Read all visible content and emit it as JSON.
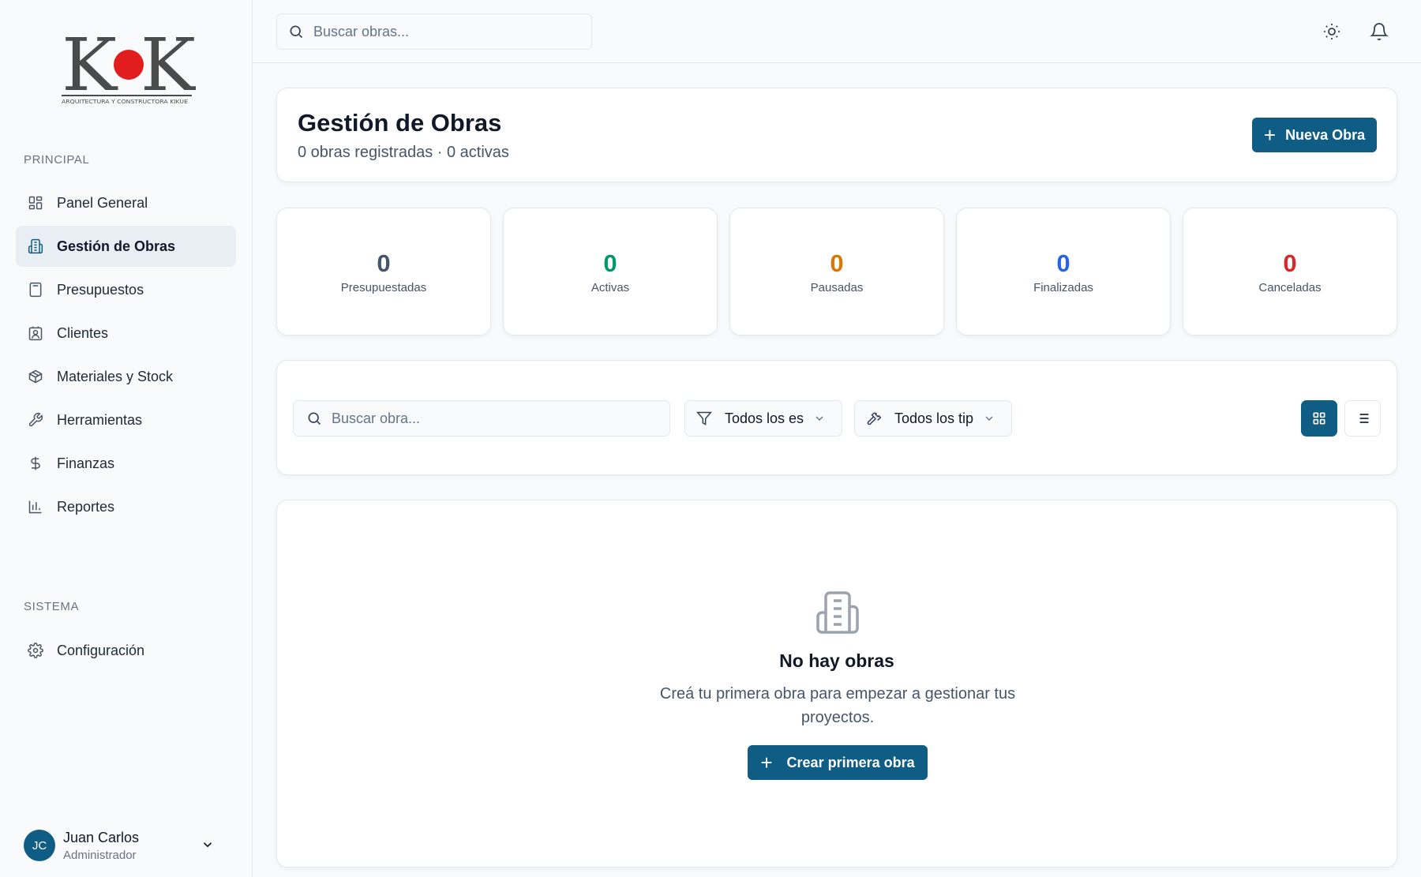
{
  "brand": {
    "logo_text": "KK",
    "logo_subtitle": "ARQUITECTURA Y CONSTRUCTORA KIKUE",
    "accent": "#0f5c85",
    "logo_red": "#e11d1d"
  },
  "topbar": {
    "search_placeholder": "Buscar obras...",
    "icons": [
      "sun-icon",
      "bell-icon"
    ]
  },
  "sidebar": {
    "section_principal": "PRINCIPAL",
    "section_sistema": "SISTEMA",
    "items": [
      {
        "label": "Panel General",
        "icon": "dashboard-icon"
      },
      {
        "label": "Gestión de Obras",
        "icon": "building-icon",
        "active": true
      },
      {
        "label": "Presupuestos",
        "icon": "calculator-icon"
      },
      {
        "label": "Clientes",
        "icon": "contact-icon"
      },
      {
        "label": "Materiales y Stock",
        "icon": "box-icon"
      },
      {
        "label": "Herramientas",
        "icon": "wrench-icon"
      },
      {
        "label": "Finanzas",
        "icon": "dollar-icon"
      },
      {
        "label": "Reportes",
        "icon": "bar-chart-icon"
      }
    ],
    "system_items": [
      {
        "label": "Configuración",
        "icon": "gear-icon"
      }
    ],
    "user": {
      "initials": "JC",
      "name": "Juan Carlos",
      "role": "Administrador"
    }
  },
  "header": {
    "title": "Gestión de Obras",
    "subtitle": "0 obras registradas · 0 activas",
    "new_button": "Nueva Obra"
  },
  "stats": [
    {
      "value": "0",
      "label": "Presupuestadas",
      "color": "#475569"
    },
    {
      "value": "0",
      "label": "Activas",
      "color": "#059669"
    },
    {
      "value": "0",
      "label": "Pausadas",
      "color": "#d97706"
    },
    {
      "value": "0",
      "label": "Finalizadas",
      "color": "#2563eb"
    },
    {
      "value": "0",
      "label": "Canceladas",
      "color": "#dc2626"
    }
  ],
  "filters": {
    "search_placeholder": "Buscar obra...",
    "status_select": "Todos los estados",
    "type_select": "Todos los tipos"
  },
  "empty": {
    "title": "No hay obras",
    "description": "Creá tu primera obra para empezar a gestionar tus proyectos.",
    "button": "Crear primera obra"
  }
}
